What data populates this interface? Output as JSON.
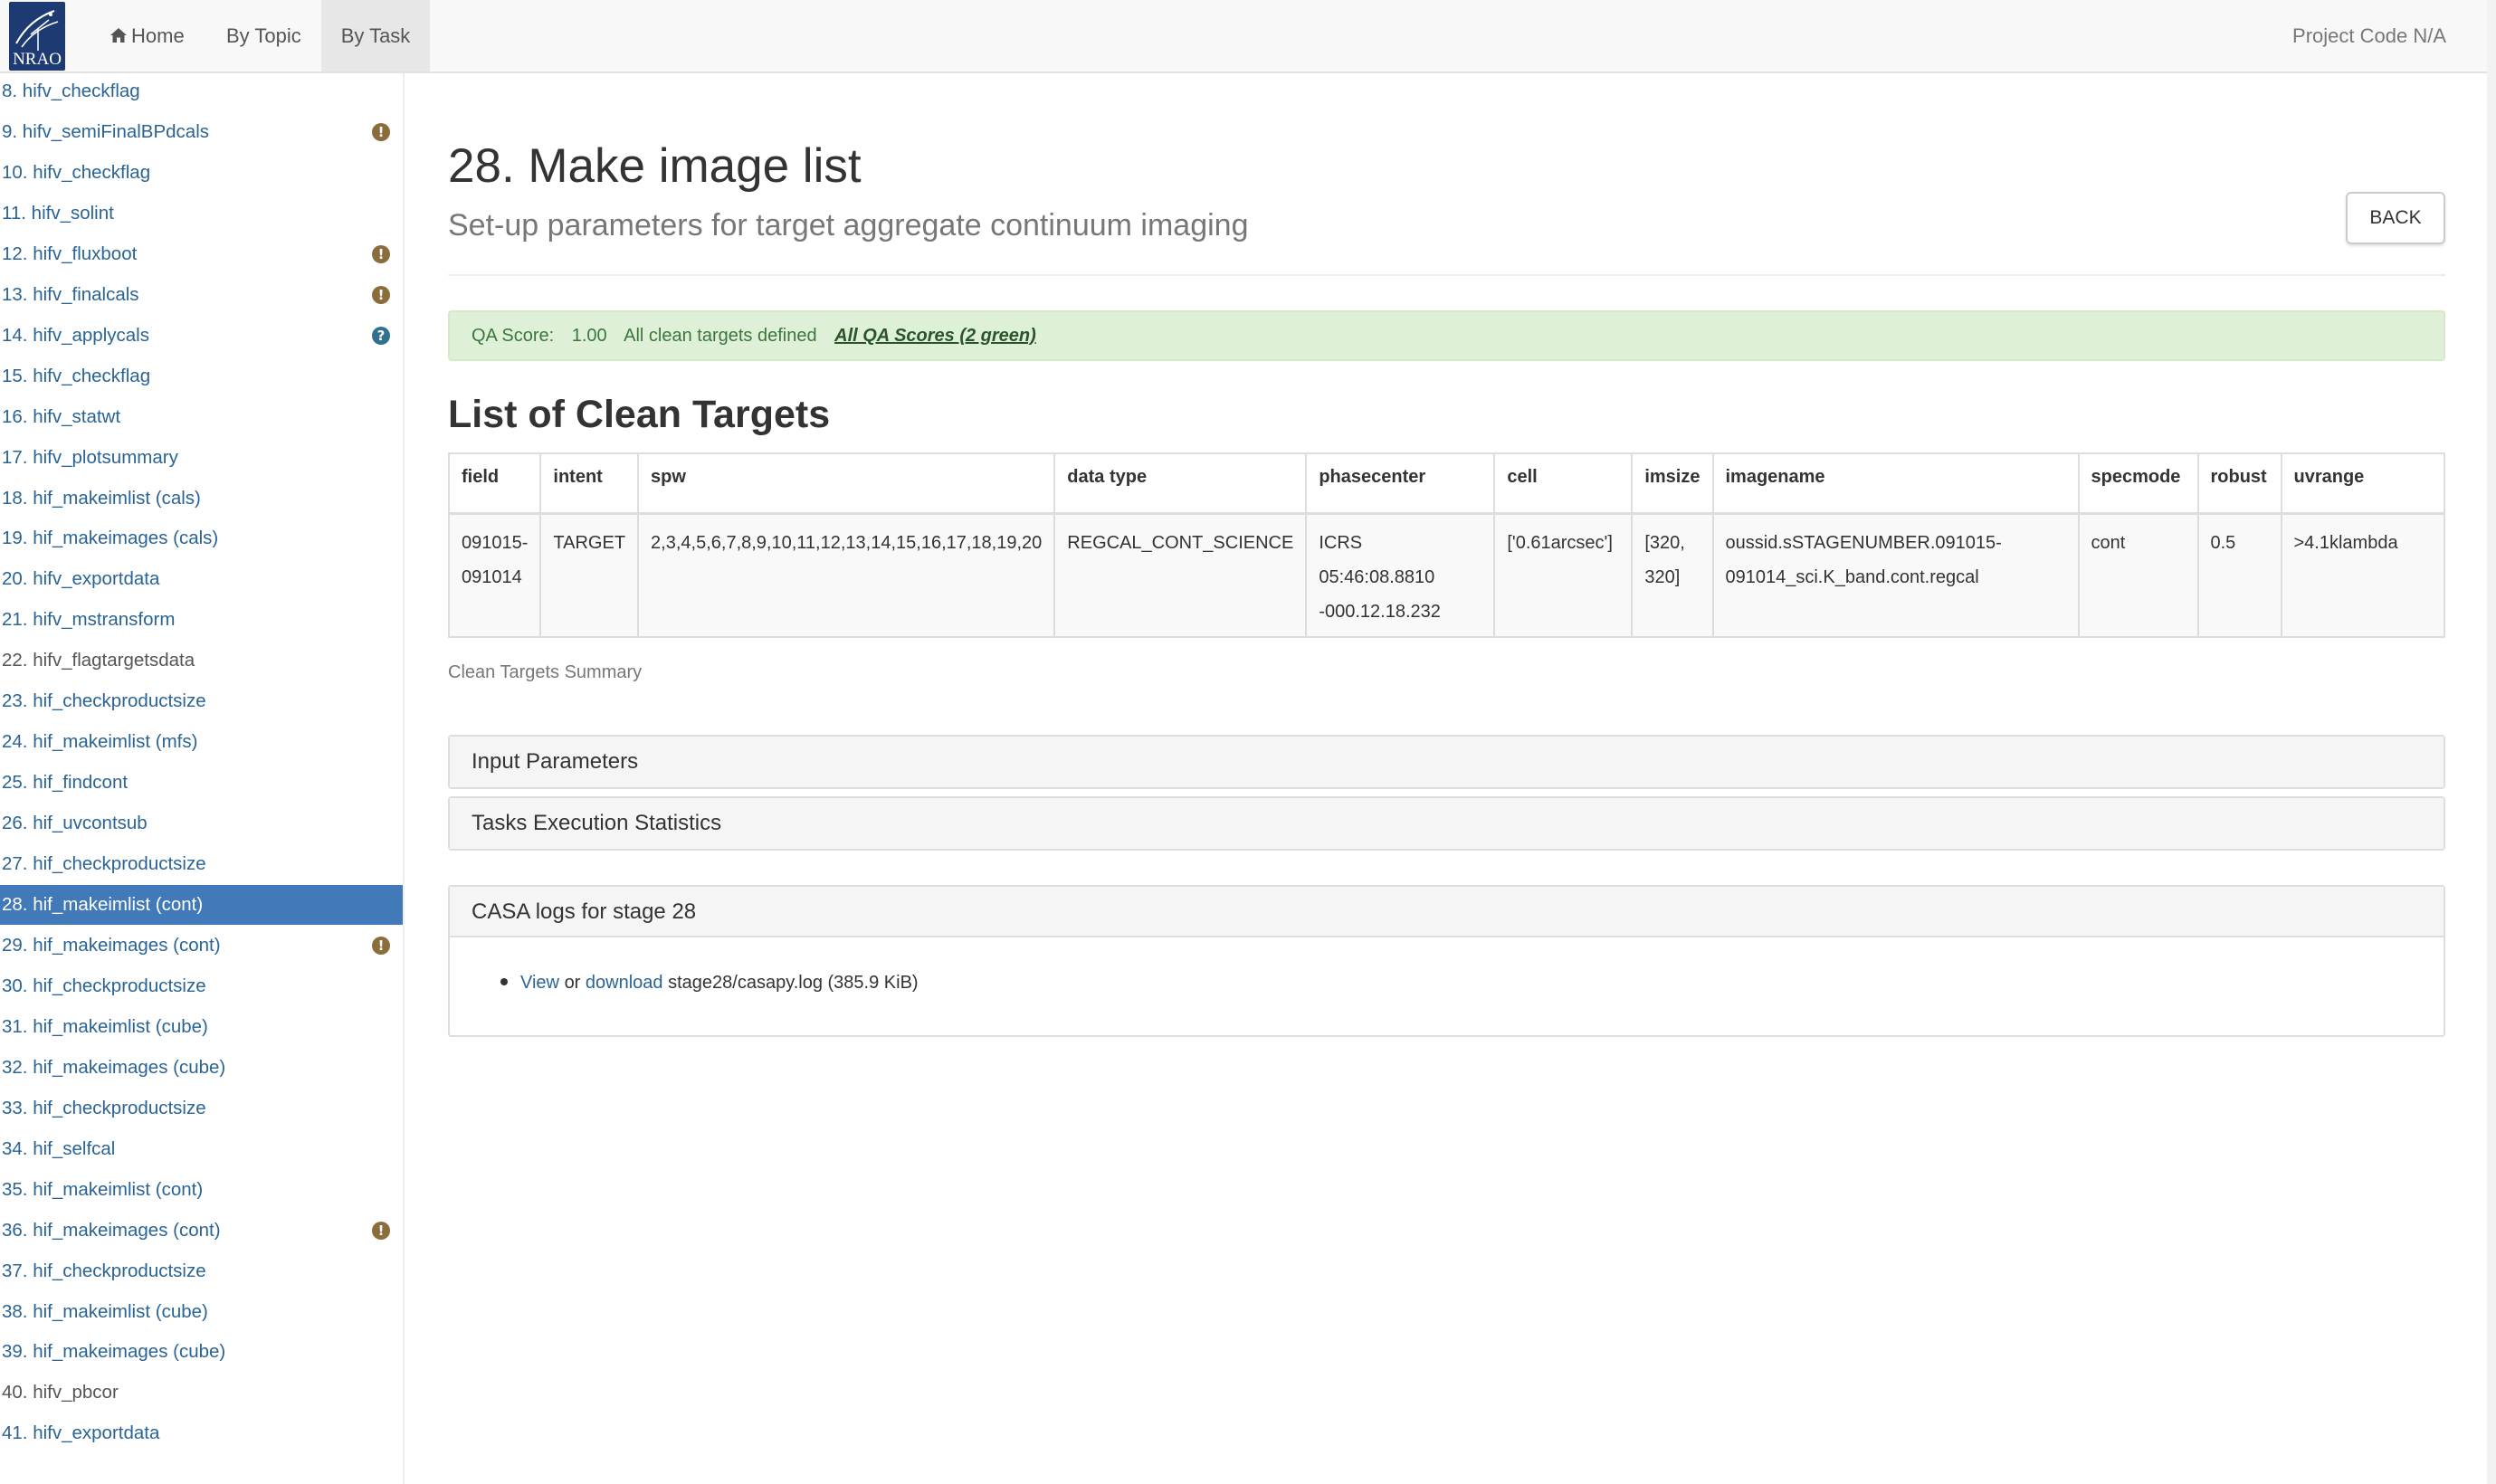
{
  "navbar": {
    "logo_text": "NRAO",
    "home": "Home",
    "by_topic": "By Topic",
    "by_task": "By Task",
    "project_code": "Project Code N/A"
  },
  "sidebar": {
    "items": [
      {
        "label": "8. hifv_checkflag",
        "state": "link",
        "badge": ""
      },
      {
        "label": "9. hifv_semiFinalBPdcals",
        "state": "link",
        "badge": "warn"
      },
      {
        "label": "10. hifv_checkflag",
        "state": "link",
        "badge": ""
      },
      {
        "label": "11. hifv_solint",
        "state": "link",
        "badge": ""
      },
      {
        "label": "12. hifv_fluxboot",
        "state": "link",
        "badge": "warn"
      },
      {
        "label": "13. hifv_finalcals",
        "state": "link",
        "badge": "warn"
      },
      {
        "label": "14. hifv_applycals",
        "state": "link",
        "badge": "info"
      },
      {
        "label": "15. hifv_checkflag",
        "state": "link",
        "badge": ""
      },
      {
        "label": "16. hifv_statwt",
        "state": "link",
        "badge": ""
      },
      {
        "label": "17. hifv_plotsummary",
        "state": "link",
        "badge": ""
      },
      {
        "label": "18. hif_makeimlist (cals)",
        "state": "link",
        "badge": ""
      },
      {
        "label": "19. hif_makeimages (cals)",
        "state": "link",
        "badge": ""
      },
      {
        "label": "20. hifv_exportdata",
        "state": "link",
        "badge": ""
      },
      {
        "label": "21. hifv_mstransform",
        "state": "link",
        "badge": ""
      },
      {
        "label": "22. hifv_flagtargetsdata",
        "state": "inactive",
        "badge": ""
      },
      {
        "label": "23. hif_checkproductsize",
        "state": "link",
        "badge": ""
      },
      {
        "label": "24. hif_makeimlist (mfs)",
        "state": "link",
        "badge": ""
      },
      {
        "label": "25. hif_findcont",
        "state": "link",
        "badge": ""
      },
      {
        "label": "26. hif_uvcontsub",
        "state": "link",
        "badge": ""
      },
      {
        "label": "27. hif_checkproductsize",
        "state": "link",
        "badge": ""
      },
      {
        "label": "28. hif_makeimlist (cont)",
        "state": "active",
        "badge": ""
      },
      {
        "label": "29. hif_makeimages (cont)",
        "state": "link",
        "badge": "warn"
      },
      {
        "label": "30. hif_checkproductsize",
        "state": "link",
        "badge": ""
      },
      {
        "label": "31. hif_makeimlist (cube)",
        "state": "link",
        "badge": ""
      },
      {
        "label": "32. hif_makeimages (cube)",
        "state": "link",
        "badge": ""
      },
      {
        "label": "33. hif_checkproductsize",
        "state": "link",
        "badge": ""
      },
      {
        "label": "34. hif_selfcal",
        "state": "link",
        "badge": ""
      },
      {
        "label": "35. hif_makeimlist (cont)",
        "state": "link",
        "badge": ""
      },
      {
        "label": "36. hif_makeimages (cont)",
        "state": "link",
        "badge": "warn"
      },
      {
        "label": "37. hif_checkproductsize",
        "state": "link",
        "badge": ""
      },
      {
        "label": "38. hif_makeimlist (cube)",
        "state": "link",
        "badge": ""
      },
      {
        "label": "39. hif_makeimages (cube)",
        "state": "link",
        "badge": ""
      },
      {
        "label": "40. hifv_pbcor",
        "state": "inactive",
        "badge": ""
      },
      {
        "label": "41. hifv_exportdata",
        "state": "link",
        "badge": ""
      }
    ]
  },
  "main": {
    "title": "28. Make image list",
    "subtitle": "Set-up parameters for target aggregate continuum imaging",
    "back_label": "BACK",
    "qa": {
      "score_label": "QA Score:",
      "score_value": "1.00",
      "message": "All clean targets defined",
      "link": "All QA Scores (2 green)"
    },
    "section_title": "List of Clean Targets",
    "table": {
      "headers": [
        "field",
        "intent",
        "spw",
        "data type",
        "phasecenter",
        "cell",
        "imsize",
        "imagename",
        "specmode",
        "robust",
        "uvrange"
      ],
      "row": {
        "field": [
          "091015-",
          "091014"
        ],
        "intent": "TARGET",
        "spw": "2,3,4,5,6,7,8,9,10,11,12,13,14,15,16,17,18,19,20",
        "data_type": "REGCAL_CONT_SCIENCE",
        "phasecenter": [
          "ICRS",
          "05:46:08.8810",
          "-000.12.18.232"
        ],
        "cell": "['0.61arcsec']",
        "imsize": [
          "[320,",
          "320]"
        ],
        "imagename": [
          "oussid.sSTAGENUMBER.091015-",
          "091014_sci.K_band.cont.regcal"
        ],
        "specmode": "cont",
        "robust": "0.5",
        "uvrange": ">4.1klambda"
      }
    },
    "caption": "Clean Targets Summary",
    "panels": {
      "input_parameters": "Input Parameters",
      "execution_stats": "Tasks Execution Statistics",
      "casa_logs": "CASA logs for stage 28"
    },
    "log": {
      "view": "View",
      "or": "or",
      "download": "download",
      "file": "stage28/casapy.log (385.9 KiB)"
    }
  },
  "colors": {
    "link": "#2a6496",
    "active_sidebar": "#4279b9",
    "warn_badge": "#8a6d3b",
    "info_badge": "#31708f",
    "qa_bg": "#dff0d8",
    "qa_text": "#3c763d"
  },
  "icons": {
    "home": "home-icon",
    "warn": "exclamation-circle-icon",
    "info": "question-circle-icon"
  }
}
